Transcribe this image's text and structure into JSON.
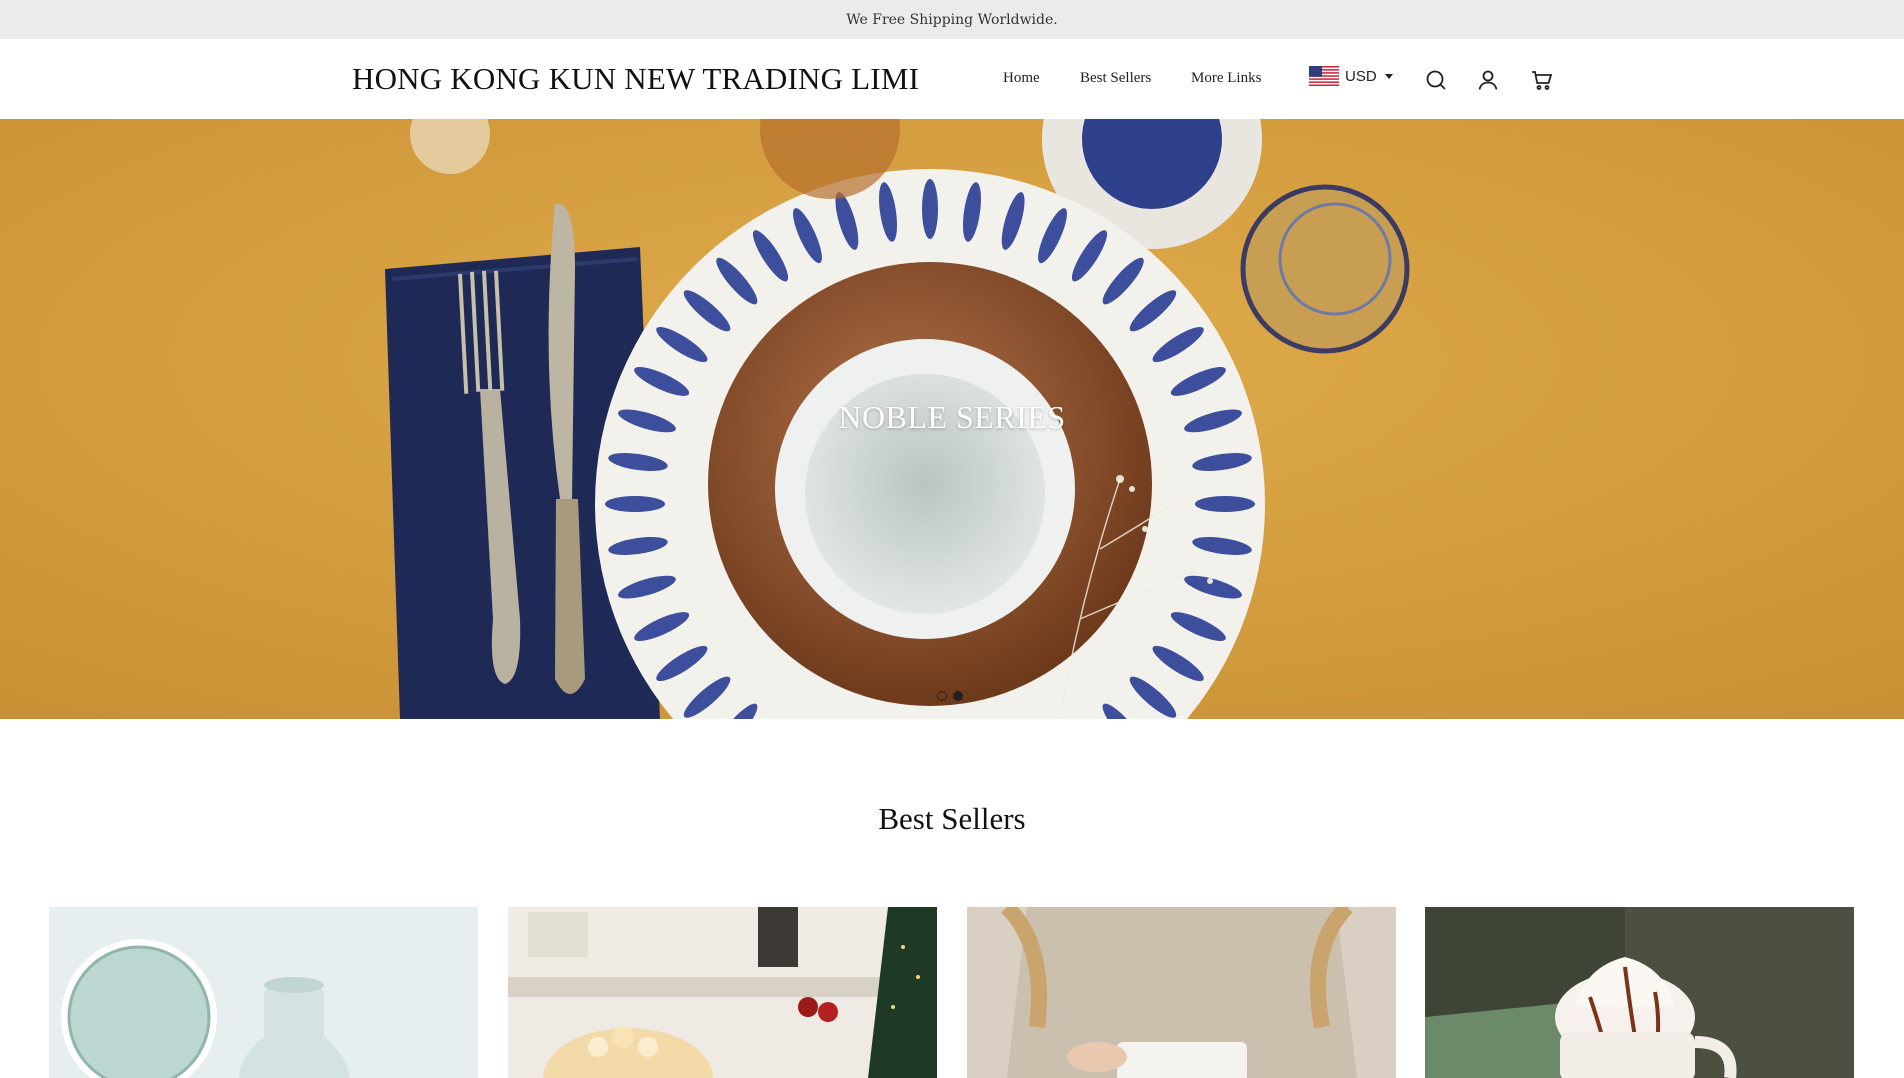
{
  "announcement": "We Free Shipping Worldwide.",
  "header": {
    "logo": "HONG KONG KUN NEW TRADING LIMI",
    "nav": [
      "Home",
      "Best Sellers",
      "More Links"
    ],
    "currency": "USD",
    "icons": [
      "us-flag-icon",
      "chevron-down-icon",
      "search-icon",
      "user-icon",
      "cart-icon"
    ]
  },
  "hero": {
    "title": "NOBLE SERIES",
    "slides": 2,
    "active_slide": 2
  },
  "best_sellers": {
    "title": "Best Sellers",
    "products": [
      {
        "image": "glass-vases-photo"
      },
      {
        "image": "popcorn-kitchen-photo"
      },
      {
        "image": "sweater-mug-photo"
      },
      {
        "image": "whipped-cream-mug-photo"
      }
    ]
  },
  "colors": {
    "announcement_bg": "#ebebeb",
    "hero_bg": "#d7a343",
    "plate_stripes": "#3d4f9c",
    "napkin": "#1e2a55"
  }
}
